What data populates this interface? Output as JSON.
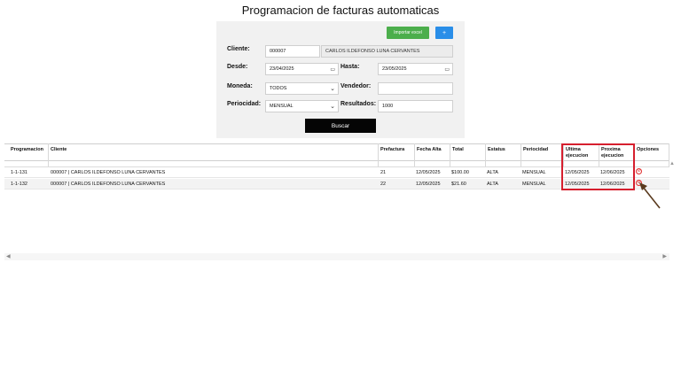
{
  "page": {
    "title": "Programacion de facturas automaticas"
  },
  "toolbar": {
    "import_excel_label": "Importar excel",
    "add_label": "+"
  },
  "form": {
    "cliente_label": "Cliente:",
    "cliente_code": "000007",
    "cliente_name": "CARLOS ILDEFONSO LUNA CERVANTES",
    "desde_label": "Desde:",
    "desde_value": "23/04/2025",
    "hasta_label": "Hasta:",
    "hasta_value": "23/05/2025",
    "moneda_label": "Moneda:",
    "moneda_value": "TODOS",
    "vendedor_label": "Vendedor:",
    "vendedor_value": "",
    "periodicidad_label": "Periocidad:",
    "periodicidad_value": "MENSUAL",
    "resultados_label": "Resultados:",
    "resultados_value": "1000",
    "buscar_label": "Buscar"
  },
  "table": {
    "headers": {
      "programacion": "Programacion",
      "cliente": "Cliente",
      "prefactura": "Prefactura",
      "fecha_alta": "Fecha Alta",
      "total": "Total",
      "estatus": "Estatus",
      "periocidad": "Periocidad",
      "ultima_1": "Ultima",
      "ultima_2": "ejecucion",
      "proxima_1": "Proxima",
      "proxima_2": "ejecucion",
      "opciones": "Opciones"
    },
    "rows": [
      {
        "programacion": "1-1-131",
        "cliente": "000007 | CARLOS ILDEFONSO LUNA CERVANTES",
        "prefactura": "21",
        "fecha_alta": "12/05/2025",
        "total": "$100.00",
        "estatus": "ALTA",
        "periocidad": "MENSUAL",
        "ultima": "12/05/2025",
        "proxima": "12/06/2025"
      },
      {
        "programacion": "1-1-132",
        "cliente": "000007 | CARLOS ILDEFONSO LUNA CERVANTES",
        "prefactura": "22",
        "fecha_alta": "12/05/2025",
        "total": "$21.60",
        "estatus": "ALTA",
        "periocidad": "MENSUAL",
        "ultima": "12/05/2025",
        "proxima": "12/06/2025"
      }
    ]
  },
  "icons": {
    "calendar": "calendar-icon",
    "chevron": "chevron-down-icon",
    "delete": "delete-icon",
    "annotation_arrow": "arrow-icon"
  },
  "colors": {
    "excel_button": "#4cae4c",
    "add_button": "#2a8ee8",
    "search_button": "#050505",
    "highlight": "#d61f2e",
    "delete_icon": "#e03030"
  }
}
